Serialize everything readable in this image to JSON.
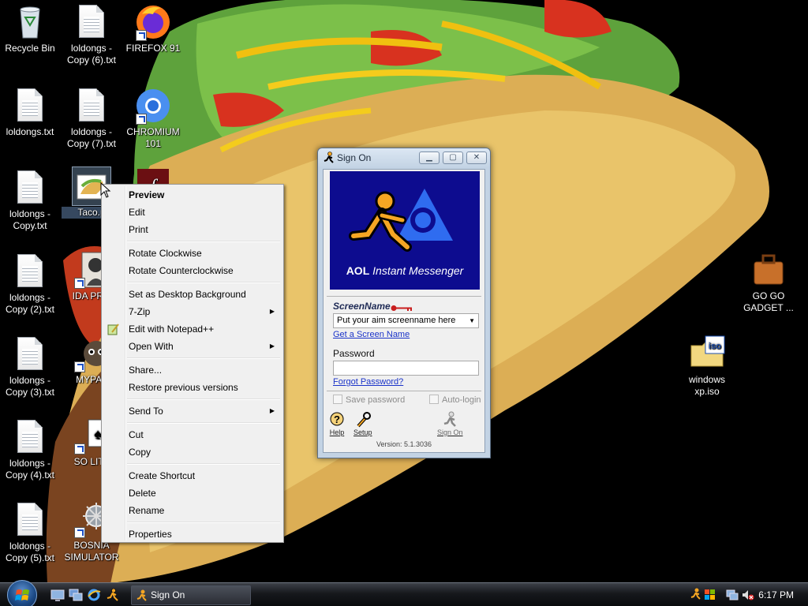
{
  "desktop": {
    "icons": [
      {
        "label": "Recycle Bin"
      },
      {
        "label": "loldongs -\nCopy (6).txt"
      },
      {
        "label": "FIREFOX 91"
      },
      {
        "label": "loldongs.txt"
      },
      {
        "label": "loldongs -\nCopy (7).txt"
      },
      {
        "label": "CHROMIUM\n101"
      },
      {
        "label": "loldongs -\nCopy.txt"
      },
      {
        "label": "Taco.p"
      },
      {
        "label": "loldongs -\nCopy (2).txt"
      },
      {
        "label": "IDA PRO"
      },
      {
        "label": "loldongs -\nCopy (3).txt"
      },
      {
        "label": "MYPAL"
      },
      {
        "label": "loldongs -\nCopy (4).txt"
      },
      {
        "label": "SO LIT!!"
      },
      {
        "label": "loldongs -\nCopy (5).txt"
      },
      {
        "label": "BOSNIA\nSIMULATOR"
      },
      {
        "label": "GO GO\nGADGET ..."
      },
      {
        "label": "windows\nxp.iso"
      }
    ]
  },
  "context_menu": {
    "items": [
      {
        "label": "Preview"
      },
      {
        "label": "Edit"
      },
      {
        "label": "Print"
      },
      {
        "label": "Rotate Clockwise"
      },
      {
        "label": "Rotate Counterclockwise"
      },
      {
        "label": "Set as Desktop Background"
      },
      {
        "label": "7-Zip"
      },
      {
        "label": "Edit with Notepad++"
      },
      {
        "label": "Open With"
      },
      {
        "label": "Share..."
      },
      {
        "label": "Restore previous versions"
      },
      {
        "label": "Send To"
      },
      {
        "label": "Cut"
      },
      {
        "label": "Copy"
      },
      {
        "label": "Create Shortcut"
      },
      {
        "label": "Delete"
      },
      {
        "label": "Rename"
      },
      {
        "label": "Properties"
      }
    ],
    "submenu_arrow": "▶"
  },
  "aim": {
    "title": "Sign On",
    "logo_brand": "AOL",
    "logo_product": "Instant Messenger",
    "screenname_label": "ScreenName",
    "screenname_value": "Put your aim screenname here",
    "get_screen_name": "Get a Screen Name",
    "password_label": "Password",
    "forgot_password": "Forgot Password?",
    "save_password": "Save password",
    "auto_login": "Auto-login",
    "help": "Help",
    "setup": "Setup",
    "sign_on": "Sign On",
    "version": "Version: 5.1.3036",
    "colors": {
      "logo_bg": "#0d0c8f",
      "runner": "#f5a623",
      "link": "#1a33c9"
    }
  },
  "taskbar": {
    "task_label": "Sign On",
    "clock": "6:17 PM"
  }
}
